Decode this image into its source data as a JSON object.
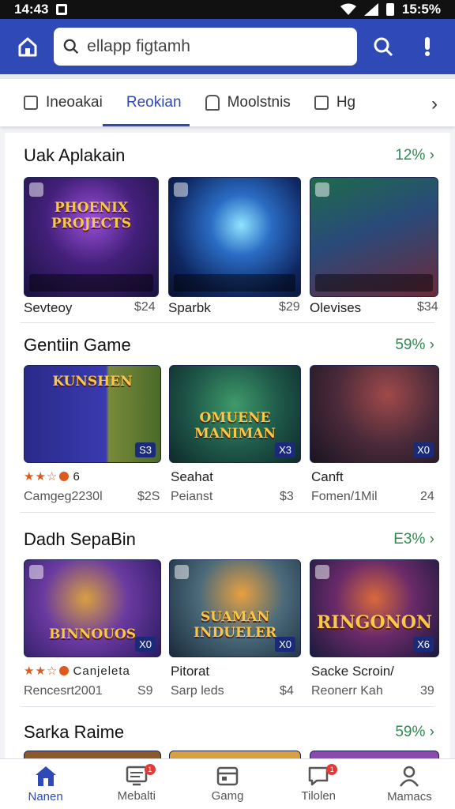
{
  "status": {
    "time": "14:43",
    "right": "15:5%"
  },
  "search": {
    "value": "",
    "placeholder": "ellapp figtamh"
  },
  "tabs": [
    {
      "label": "Ineoakai",
      "icon": "checkbox-icon"
    },
    {
      "label": "Reokian",
      "icon": "none",
      "active": true
    },
    {
      "label": "Moolstnis",
      "icon": "home-outline-icon"
    },
    {
      "label": "Hg",
      "icon": "checkbox-icon"
    }
  ],
  "sections": [
    {
      "title": "Uak Aplakain",
      "more": "12%",
      "cards": [
        {
          "caption": "PHOENIX PROJECTS",
          "title": "Sevteoy",
          "price": "$24"
        },
        {
          "caption": "",
          "title": "Sparbk",
          "price": "$29"
        },
        {
          "caption": "",
          "title": "Olevises",
          "price": "$34"
        }
      ]
    },
    {
      "title": "Gentiin Game",
      "more": "59%",
      "cards": [
        {
          "caption": "KUNSHEN",
          "badge": "S3",
          "rating": "6",
          "title": "",
          "sub": "Camgeg2230l",
          "price": "$2S"
        },
        {
          "caption": "OMUENE MANIMAN",
          "badge": "X3",
          "title": "Seahat",
          "sub": "Peianst",
          "price": "$3"
        },
        {
          "caption": "",
          "badge": "X0",
          "title": "Canft",
          "sub": "Fomen/1Mil",
          "price": "24"
        }
      ]
    },
    {
      "title": "Dadh SepaBin",
      "more": "E3%",
      "cards": [
        {
          "caption": "BINNOUOS",
          "badge": "X0",
          "rating": "Canjeleta",
          "sub": "Rencesrt2001",
          "price": "S9"
        },
        {
          "caption": "SUAMAN INDUELER",
          "badge": "X0",
          "title": "Pitorat",
          "sub": "Sarp leds",
          "price": "$4"
        },
        {
          "caption": "RINGONON",
          "badge": "X6",
          "title": "Sacke Scroin/",
          "sub": "Reonerr Kah",
          "price": "39"
        }
      ]
    },
    {
      "title": "Sarka Raime",
      "more": "59%"
    }
  ],
  "nav": [
    {
      "label": "Nanen",
      "active": true
    },
    {
      "label": "Mebalti",
      "badge": "1"
    },
    {
      "label": "Gamg"
    },
    {
      "label": "Tilolen",
      "badge": "1"
    },
    {
      "label": "Mamacs"
    }
  ],
  "colors": {
    "brand": "#2f49b7",
    "more": "#2e8a4f",
    "star": "#e0591c"
  }
}
